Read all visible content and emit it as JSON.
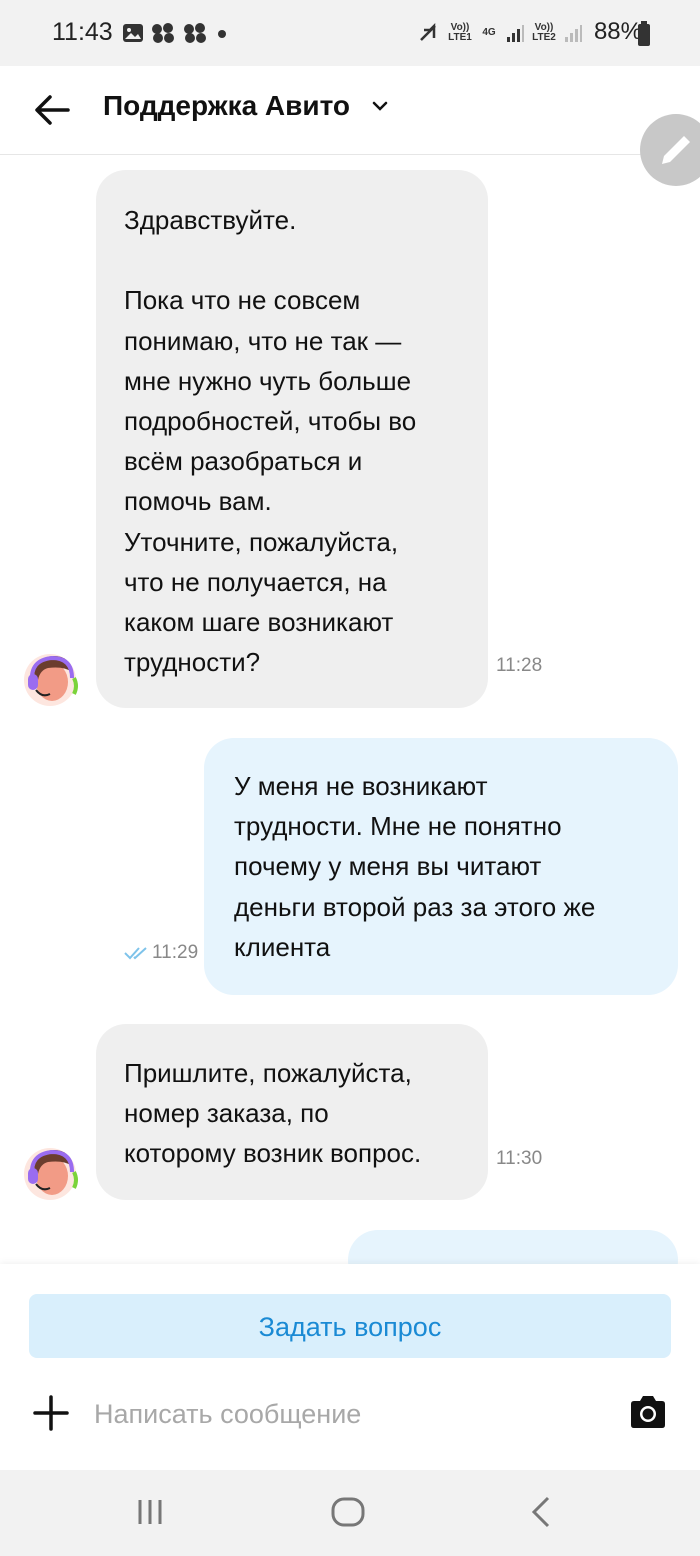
{
  "status_bar": {
    "time": "11:43",
    "battery": "88%",
    "sim1": "Vo)) LTE1",
    "sim2": "Vo)) LTE2",
    "network": "4G"
  },
  "header": {
    "title": "Поддержка Авито"
  },
  "messages": [
    {
      "direction": "incoming",
      "text": "Здравствуйте.\n\nПока что не совсем\nпонимаю, что не так —\nмне нужно чуть больше\nподробностей, чтобы во\nвсём разобраться и\nпомочь вам.\nУточните, пожалуйста,\nчто не получается, на\nкаком шаге возникают\nтрудности?",
      "time": "11:28"
    },
    {
      "direction": "outgoing",
      "text": "У меня не возникают\nтрудности. Мне не понятно\nпочему у меня вы читают\nденьги второй раз за этого же\nклиента",
      "time": "11:29"
    },
    {
      "direction": "incoming",
      "text": "Пришлите, пожалуйста,\nномер заказа, по\nкоторому возник вопрос.",
      "time": "11:30"
    }
  ],
  "bottom": {
    "ask_button": "Задать вопрос",
    "input_placeholder": "Написать сообщение"
  },
  "colors": {
    "incoming_bubble": "#efefef",
    "outgoing_bubble": "#e6f4fd",
    "accent": "#1a8ad4",
    "read_ticks": "#7ec3ea"
  }
}
